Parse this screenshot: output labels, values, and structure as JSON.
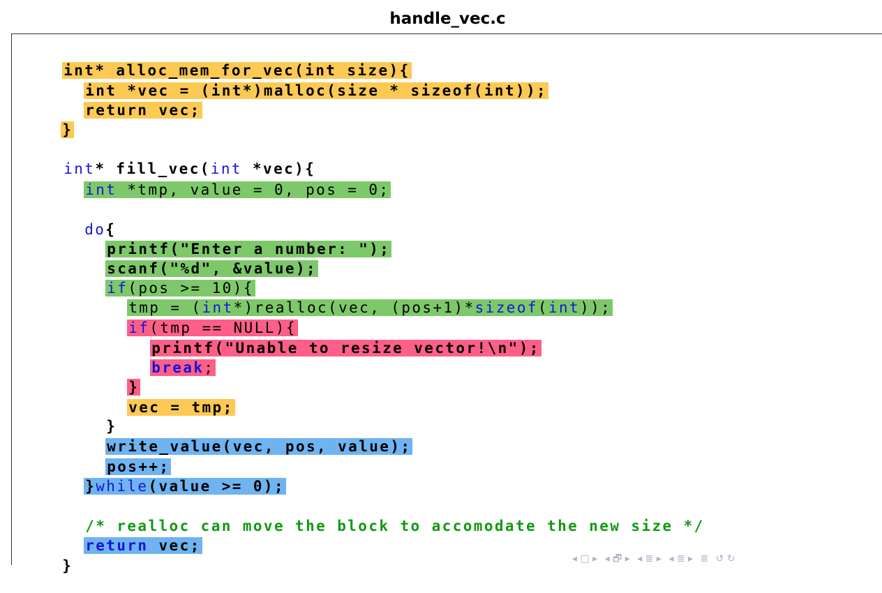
{
  "title": "handle_vec.c",
  "code": {
    "l1": "int* alloc_mem_for_vec(int size){",
    "l2": "int *vec = (int*)malloc(size * sizeof(int));",
    "l3": "return vec;",
    "l4": "}",
    "l5a": "int",
    "l5b": "* fill_vec(",
    "l5c": "int",
    "l5d": " *vec){",
    "l6a": "int",
    "l6b": " *tmp, value = 0, pos = 0;",
    "l7a": "do",
    "l7b": "{",
    "l8": "printf(\"Enter a number: \");",
    "l9": "scanf(\"%d\", &value);",
    "l10a": "if",
    "l10b": "(pos >= 10){",
    "l11a": "tmp = (",
    "l11b": "int",
    "l11c": "*)realloc(vec, (pos+1)*",
    "l11d": "sizeof",
    "l11e": "(",
    "l11f": "int",
    "l11g": "));",
    "l12a": "if",
    "l12b": "(tmp == NULL){",
    "l13": "printf(\"Unable to resize vector!\\n\");",
    "l14a": "break",
    "l14b": ";",
    "l15": "}",
    "l16": "vec = tmp;",
    "l17": "}",
    "l18": "write_value(vec, pos, value);",
    "l19": "pos++;",
    "l20a": "}",
    "l20b": "while",
    "l20c": "(value >= 0);",
    "l21": "/* realloc can move the block to accomodate the new size */",
    "l22a": "return",
    "l22b": " vec;",
    "l23": "}"
  },
  "nav": {
    "prev_frame": "◂ □ ▸",
    "prev_sub": "◂ 🗗 ▸",
    "section": "◂ ≣ ▸",
    "subsection": "◂ ≣ ▸",
    "outline": "≣",
    "search": "↺ ↻"
  },
  "colors": {
    "yellow": "#fdc955",
    "green": "#7dc96a",
    "red": "#fd5f88",
    "blue": "#6fb3f0",
    "keyword": "#1515d8",
    "comment": "#119911"
  }
}
